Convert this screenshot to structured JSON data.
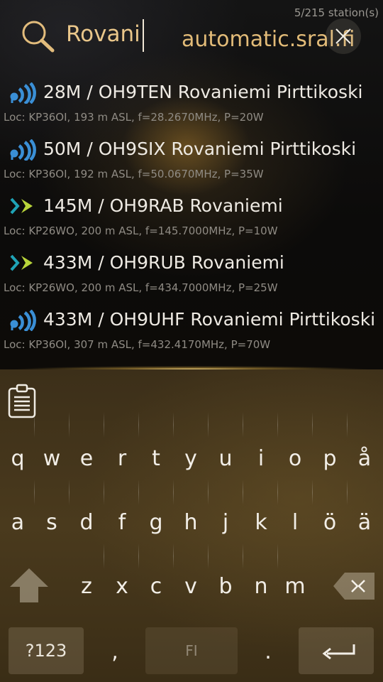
{
  "status": {
    "count": "5/215 station(s)"
  },
  "search": {
    "query": "Rovani",
    "server": "automatic.sral.fi"
  },
  "stations": [
    {
      "icon": "wifi-blue",
      "title": "28M / OH9TEN Rovaniemi Pirttikoski",
      "detail": "Loc: KP36OI, 193 m ASL, f=28.2670MHz, P=20W"
    },
    {
      "icon": "wifi-blue",
      "title": "50M / OH9SIX Rovaniemi Pirttikoski",
      "detail": "Loc: KP36OI, 192 m ASL, f=50.0670MHz, P=35W"
    },
    {
      "icon": "chevron-green",
      "title": "145M / OH9RAB Rovaniemi",
      "detail": "Loc: KP26WO, 200 m ASL, f=145.7000MHz, P=10W"
    },
    {
      "icon": "chevron-green",
      "title": "433M / OH9RUB Rovaniemi",
      "detail": "Loc: KP26WO, 200 m ASL, f=434.7000MHz, P=25W"
    },
    {
      "icon": "wifi-blue",
      "title": "433M / OH9UHF Rovaniemi Pirttikoski",
      "detail": "Loc: KP36OI, 307 m ASL, f=432.4170MHz, P=70W"
    }
  ],
  "keyboard": {
    "row1": [
      "q",
      "w",
      "e",
      "r",
      "t",
      "y",
      "u",
      "i",
      "o",
      "p",
      "å"
    ],
    "row2": [
      "a",
      "s",
      "d",
      "f",
      "g",
      "h",
      "j",
      "k",
      "l",
      "ö",
      "ä"
    ],
    "row3": [
      "z",
      "x",
      "c",
      "v",
      "b",
      "n",
      "m"
    ],
    "symbols_label": "?123",
    "comma": ",",
    "space_label": "FI",
    "period": "."
  },
  "colors": {
    "accent": "#e9c68a",
    "blue_icon": "#3a8fd6",
    "green_icon": "#b9d53a",
    "keyboard_bg": "#43341b"
  }
}
